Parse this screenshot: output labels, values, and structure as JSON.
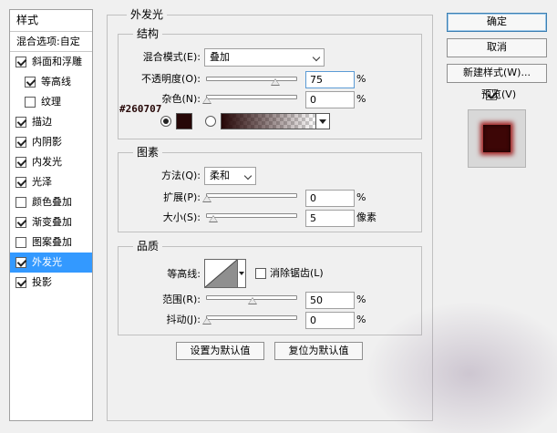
{
  "left_panel": {
    "header": "样式",
    "blend_options": "混合选项:自定",
    "items": [
      {
        "label": "斜面和浮雕",
        "checked": true
      },
      {
        "label": "等高线",
        "checked": true
      },
      {
        "label": "纹理",
        "checked": false
      },
      {
        "label": "描边",
        "checked": true
      },
      {
        "label": "内阴影",
        "checked": true
      },
      {
        "label": "内发光",
        "checked": true
      },
      {
        "label": "光泽",
        "checked": true
      },
      {
        "label": "颜色叠加",
        "checked": false
      },
      {
        "label": "渐变叠加",
        "checked": true
      },
      {
        "label": "图案叠加",
        "checked": false
      },
      {
        "label": "外发光",
        "checked": true
      },
      {
        "label": "投影",
        "checked": true
      }
    ]
  },
  "outer_glow": {
    "title": "外发光",
    "structure": {
      "title": "结构",
      "blend_mode_label": "混合模式(E):",
      "blend_mode_value": "叠加",
      "opacity_label": "不透明度(O):",
      "opacity_value": "75",
      "opacity_unit": "%",
      "noise_label": "杂色(N):",
      "noise_value": "0",
      "noise_unit": "%",
      "color_hex": "#260707",
      "color_annotation": "#260707"
    },
    "elements": {
      "title": "图素",
      "method_label": "方法(Q):",
      "method_value": "柔和",
      "spread_label": "扩展(P):",
      "spread_value": "0",
      "spread_unit": "%",
      "size_label": "大小(S):",
      "size_value": "5",
      "size_unit": "像素"
    },
    "quality": {
      "title": "品质",
      "contour_label": "等高线:",
      "antialias_label": "消除锯齿(L)",
      "antialias_checked": false,
      "range_label": "范围(R):",
      "range_value": "50",
      "range_unit": "%",
      "jitter_label": "抖动(J):",
      "jitter_value": "0",
      "jitter_unit": "%"
    },
    "set_default_label": "设置为默认值",
    "reset_default_label": "复位为默认值"
  },
  "right_panel": {
    "ok_label": "确定",
    "cancel_label": "取消",
    "new_style_label": "新建样式(W)...",
    "preview_label": "预览(V)",
    "preview_checked": true
  }
}
